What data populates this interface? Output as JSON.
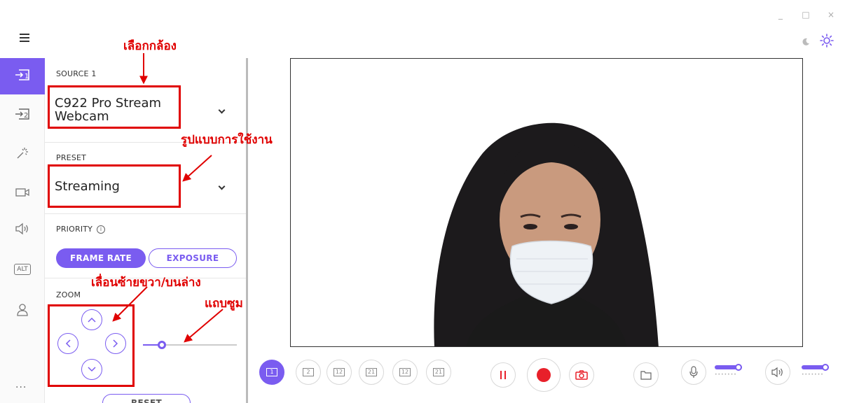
{
  "window": {
    "minimize": "_",
    "maximize": "□",
    "close": "×"
  },
  "theme": {
    "dark_icon": "moon-icon",
    "light_icon": "sun-icon"
  },
  "rail": {
    "items": [
      "source-1-icon",
      "source-2-icon",
      "effects-icon",
      "camera-icon",
      "audio-icon",
      "alt-icon",
      "profile-icon"
    ],
    "alt_label": "ALT",
    "source1_num": "1",
    "source2_num": "2",
    "more": "..."
  },
  "panel": {
    "source_label": "SOURCE 1",
    "source_value_line1": "C922 Pro Stream",
    "source_value_line2": "Webcam",
    "preset_label": "PRESET",
    "preset_value": "Streaming",
    "priority_label": "PRIORITY",
    "priority_info": "i",
    "frame_rate": "FRAME RATE",
    "exposure": "EXPOSURE",
    "zoom_label": "ZOOM",
    "zoom_level": 0.2,
    "reset": "RESET"
  },
  "annotations": {
    "select_camera": "เลือกกล้อง",
    "usage_format": "รูปแบบการใช้งาน",
    "pan_tilt": "เลื่อนซ้ายขวา/บนล่าง",
    "zoom_bar": "แถบซูม"
  },
  "bottom": {
    "layouts": [
      "1",
      "2",
      "12",
      "21",
      "12",
      "21"
    ],
    "mic_level": 0.85,
    "speaker_level": 0.85
  },
  "colors": {
    "accent": "#7a5cf0",
    "annotation": "#e00000",
    "record": "#e8202a"
  }
}
